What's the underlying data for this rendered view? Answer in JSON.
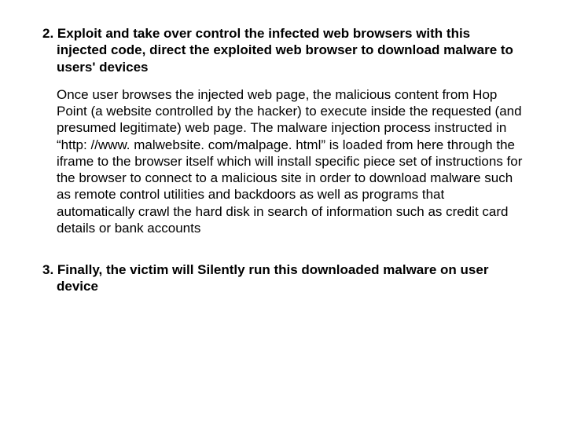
{
  "item2": {
    "number": "2.",
    "heading": "Exploit and take over control the infected web browsers with this injected code, direct the exploited web browser to download malware to users' devices",
    "body": "Once user browses the injected web page, the malicious content from Hop Point (a website controlled by the hacker) to execute inside the requested (and presumed legitimate) web page. The malware injection process instructed in “http: //www. malwebsite. com/malpage. html” is loaded from here through the iframe to the  browser itself which  will install specific piece set of instructions for the browser to connect to a malicious site in order to download malware such as remote control utilities and backdoors as well as programs that automatically crawl the hard disk in search of information such as credit card details or bank accounts"
  },
  "item3": {
    "number": "3.",
    "heading": "Finally, the victim will Silently run this downloaded malware on user device"
  }
}
